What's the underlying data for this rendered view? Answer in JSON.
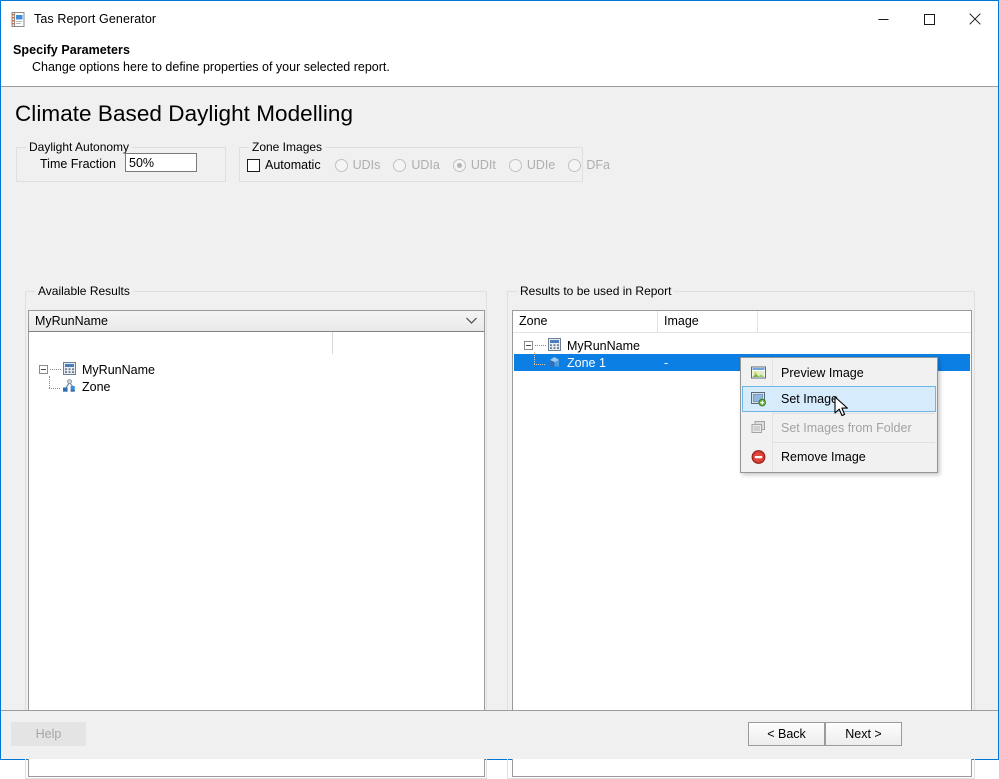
{
  "window": {
    "title": "Tas Report Generator",
    "icon": "report-document-icon",
    "caption_buttons": [
      {
        "name": "minimize",
        "label": "Minimize"
      },
      {
        "name": "maximize",
        "label": "Maximize"
      },
      {
        "name": "close",
        "label": "Close"
      }
    ]
  },
  "header": {
    "title": "Specify Parameters",
    "subtitle": "Change options here to define properties of your selected report."
  },
  "page": {
    "title": "Climate Based Daylight Modelling"
  },
  "daylight_autonomy": {
    "group_label": "Daylight Autonomy",
    "time_fraction_label": "Time Fraction",
    "time_fraction_value": "50%",
    "time_fraction_placeholder": ""
  },
  "zone_images": {
    "group_label": "Zone Images",
    "automatic_label": "Automatic",
    "automatic_checked": false,
    "options": [
      {
        "label": "UDIs",
        "selected": false,
        "disabled": true
      },
      {
        "label": "UDIa",
        "selected": false,
        "disabled": true
      },
      {
        "label": "UDIt",
        "selected": true,
        "disabled": true
      },
      {
        "label": "UDIe",
        "selected": false,
        "disabled": true
      },
      {
        "label": "DFa",
        "selected": false,
        "disabled": true
      }
    ]
  },
  "available_results": {
    "group_label": "Available Results",
    "combo_value": "MyRunName",
    "tree": [
      {
        "label": "MyRunName",
        "icon": "calculator-run-icon",
        "level": 0,
        "expanded": true
      },
      {
        "label": "Zone",
        "icon": "zone-node-icon",
        "level": 1,
        "expanded": false
      }
    ]
  },
  "report_results": {
    "group_label": "Results to be used in Report",
    "columns": [
      {
        "key": "zone",
        "label": "Zone"
      },
      {
        "key": "image",
        "label": "Image"
      }
    ],
    "rows": [
      {
        "zone": "MyRunName",
        "image": "",
        "icon": "calculator-run-icon",
        "level": 0,
        "selected": false,
        "expanded": true
      },
      {
        "zone": "Zone 1",
        "image": "-",
        "icon": "zone-block-icon",
        "level": 1,
        "selected": true,
        "expanded": false
      }
    ]
  },
  "context_menu": {
    "items": [
      {
        "label": "Preview Image",
        "icon": "preview-image-icon",
        "disabled": false,
        "selected": false
      },
      {
        "label": "Set Image",
        "icon": "set-image-icon",
        "disabled": false,
        "selected": true
      },
      {
        "label": "Set Images from Folder",
        "icon": "set-images-folder-icon",
        "disabled": true,
        "selected": false
      },
      {
        "label": "Remove Image",
        "icon": "remove-image-icon",
        "disabled": false,
        "selected": false
      }
    ]
  },
  "footer": {
    "help_label": "Help",
    "help_disabled": true,
    "back_label": "< Back",
    "next_label": "Next >"
  },
  "colors": {
    "accent": "#0078d7",
    "selection": "#0c7fe4",
    "menu_highlight": "#d6ebfb",
    "surface": "#f0f0f0",
    "disabled_text": "#a2a2a2"
  }
}
